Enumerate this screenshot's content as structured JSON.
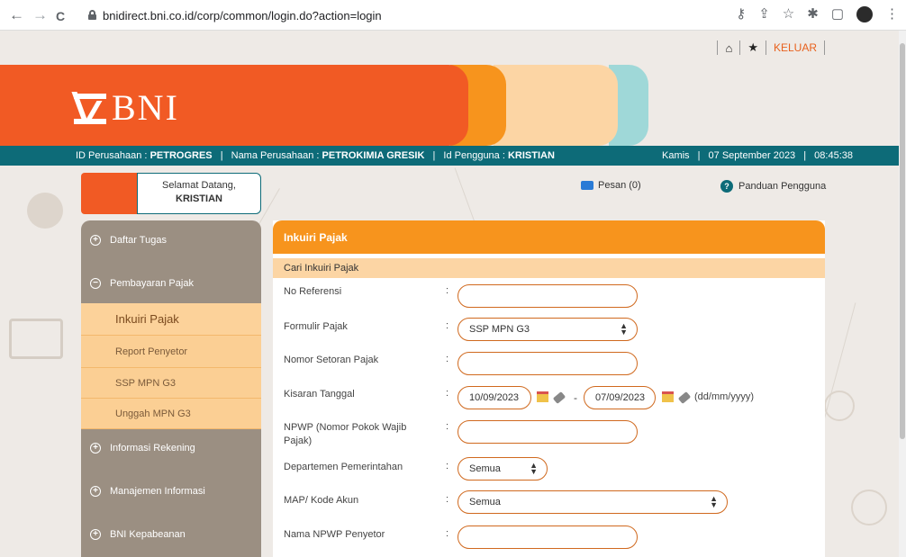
{
  "browser": {
    "back": "←",
    "forward": "→",
    "reload": "C",
    "url": "bnidirect.bni.co.id/corp/common/login.do?action=login"
  },
  "topnav": {
    "logout_label": "KELUAR"
  },
  "logo": {
    "text": "BNI"
  },
  "infobar": {
    "company_id_label": "ID Perusahaan :",
    "company_id": "PETROGRES",
    "company_name_label": "Nama Perusahaan :",
    "company_name": "PETROKIMIA GRESIK",
    "user_id_label": "Id Pengguna :",
    "user_id": "KRISTIAN",
    "day": "Kamis",
    "date": "07 September 2023",
    "time": "08:45:38"
  },
  "greeting": {
    "title": "Selamat Datang,",
    "name": "KRISTIAN"
  },
  "links": {
    "messages": "Pesan (0)",
    "guide": "Panduan Pengguna"
  },
  "sidebar": {
    "items": [
      {
        "label": "Daftar Tugas",
        "icon": "+"
      },
      {
        "label": "Pembayaran Pajak",
        "icon": "−"
      },
      {
        "label": "Informasi Rekening",
        "icon": "+"
      },
      {
        "label": "Manajemen Informasi",
        "icon": "+"
      },
      {
        "label": "BNI Kepabeanan",
        "icon": "+"
      }
    ],
    "subitems": [
      "Inkuiri Pajak",
      "Report Penyetor",
      "SSP MPN G3",
      "Unggah MPN G3"
    ]
  },
  "panel": {
    "title": "Inkuiri Pajak",
    "section": "Cari Inkuiri Pajak",
    "fields": {
      "no_referensi": {
        "label": "No Referensi",
        "value": ""
      },
      "formulir_pajak": {
        "label": "Formulir Pajak",
        "value": "SSP MPN G3"
      },
      "nomor_setoran": {
        "label": "Nomor Setoran Pajak",
        "value": ""
      },
      "kisaran_tanggal": {
        "label": "Kisaran Tanggal",
        "from": "10/09/2023",
        "to": "07/09/2023",
        "hint": "(dd/mm/yyyy)"
      },
      "npwp": {
        "label": "NPWP (Nomor Pokok Wajib Pajak)",
        "value": ""
      },
      "departemen": {
        "label": "Departemen Pemerintahan",
        "value": "Semua"
      },
      "map": {
        "label": "MAP/ Kode Akun",
        "value": "Semua"
      },
      "nama_npwp": {
        "label": "Nama NPWP Penyetor",
        "value": ""
      }
    },
    "colon": ":",
    "dash": "-"
  }
}
